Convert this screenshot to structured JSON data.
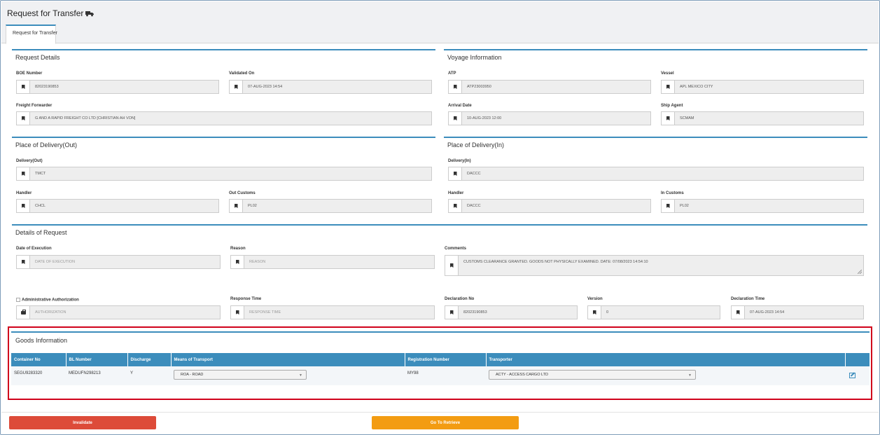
{
  "header": {
    "title": "Request for Transfer",
    "title_icon": "truck-icon"
  },
  "tabs": [
    {
      "label": "Request for Transfer",
      "active": true
    }
  ],
  "request_details": {
    "title": "Request Details",
    "boe_label": "BOE Number",
    "boe_value": "82023190853",
    "validated_label": "Validated On",
    "validated_value": "07-AUG-2023 14:54",
    "forwarder_label": "Freight Forwarder",
    "forwarder_value": "G AND A RAPID FREIGHT CO LTD [CHRISTIAN AH VON]"
  },
  "voyage": {
    "title": "Voyage Information",
    "atp_label": "ATP",
    "atp_value": "ATP23003950",
    "vessel_label": "Vessel",
    "vessel_value": "APL MEXICO CITY",
    "arrival_label": "Arrival Date",
    "arrival_value": "10-AUG-2023 12:00",
    "agent_label": "Ship Agent",
    "agent_value": "SCMAM"
  },
  "delivery_out": {
    "title": "Place of Delivery(Out)",
    "delivery_label": "Delivery(Out)",
    "delivery_value": "TMCT",
    "handler_label": "Handler",
    "handler_value": "CHCL",
    "customs_label": "Out Customs",
    "customs_value": "PL02"
  },
  "delivery_in": {
    "title": "Place of Delivery(In)",
    "delivery_label": "Delivery(In)",
    "delivery_value": "DACCC",
    "handler_label": "Handler",
    "handler_value": "DACCC",
    "customs_label": "In Customs",
    "customs_value": "PL02"
  },
  "request": {
    "title": "Details of Request",
    "execution_label": "Date of Execution",
    "execution_placeholder": "DATE OF EXECUTION",
    "reason_label": "Reason",
    "reason_placeholder": "REASON",
    "comments_label": "Comments",
    "comments_value": "CUSTOMS CLEARANCE GRANTED. GOODS NOT PHYSICALLY EXAMINED.  DATE: 07/08/2023 14:54:10",
    "auth_label": "Administrative Authorization",
    "auth_placeholder": "AUTHORIZATION",
    "response_label": "Response Time",
    "response_placeholder": "RESPONSE TIME",
    "declaration_label": "Declaration No",
    "declaration_value": "82023190853",
    "version_label": "Version",
    "version_value": "0",
    "declaration_time_label": "Declaration Time",
    "declaration_time_value": "07-AUG-2023 14:54"
  },
  "goods": {
    "title": "Goods Information",
    "columns": [
      "Container No",
      "BL Number",
      "Discharge",
      "Means of Transport",
      "Registration Number",
      "Transporter"
    ],
    "row": {
      "container": "SEGU9283320",
      "bl": "MEDUFN298213",
      "discharge": "Y",
      "transport": "ROA - ROAD",
      "registration": "MY98",
      "transporter": "ACTY - ACCESS CARGO LTD"
    }
  },
  "actions": {
    "invalidate": "Invalidate",
    "retrieve": "Go To Retrieve"
  },
  "colors": {
    "accent": "#3c8dbc",
    "danger": "#dd4b39",
    "warning": "#f39c12",
    "highlight": "#d0021b"
  }
}
